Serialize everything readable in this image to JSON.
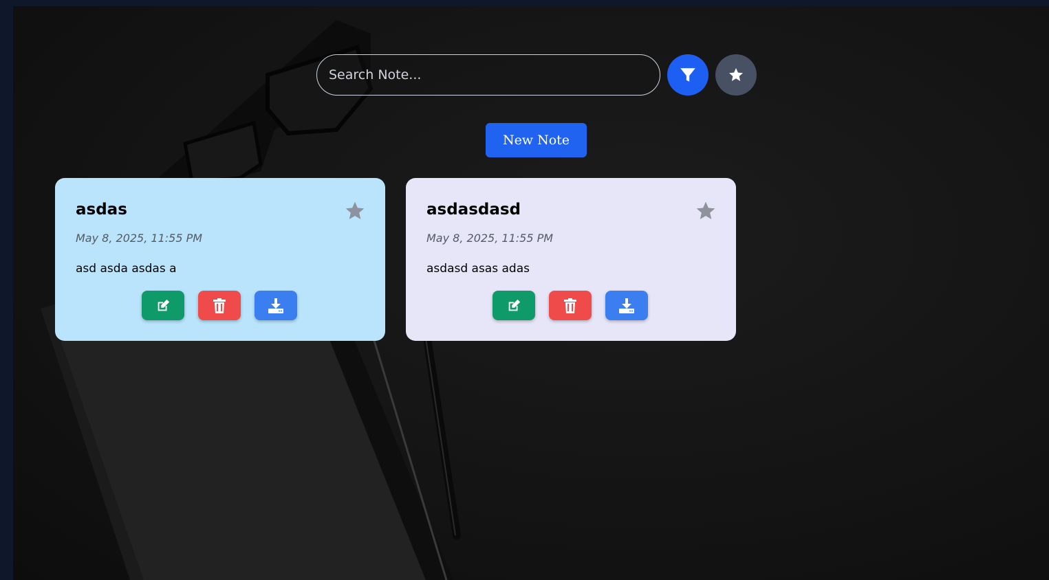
{
  "search": {
    "placeholder": "Search Note..."
  },
  "toolbar": {
    "filter_icon": "filter-icon",
    "favorites_icon": "star-icon",
    "new_note_label": "New Note"
  },
  "notes": [
    {
      "title": "asdas",
      "date": "May 8, 2025, 11:55 PM",
      "body": "asd asda asdas a",
      "color": "#b9e4fc",
      "favorited": false
    },
    {
      "title": "asdasdasd",
      "date": "May 8, 2025, 11:55 PM",
      "body": "asdasd asas adas",
      "color": "#e6e6f8",
      "favorited": false
    }
  ],
  "colors": {
    "primary": "#1f63f0",
    "edit": "#0f9a6a",
    "delete": "#ef4b4b",
    "download": "#3b7ef0",
    "star_inactive": "#8d929c"
  }
}
